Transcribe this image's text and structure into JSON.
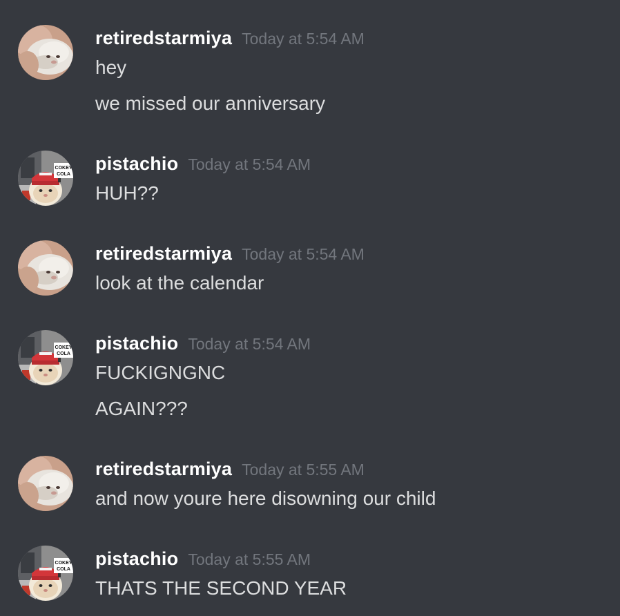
{
  "messages": [
    {
      "username": "retiredstarmiya",
      "timestamp": "Today at 5:54 AM",
      "avatar": "hamster-avatar",
      "lines": [
        "hey",
        "we missed our anniversary"
      ]
    },
    {
      "username": "pistachio",
      "timestamp": "Today at 5:54 AM",
      "avatar": "cat-cap-avatar",
      "lines": [
        "HUH??"
      ]
    },
    {
      "username": "retiredstarmiya",
      "timestamp": "Today at 5:54 AM",
      "avatar": "hamster-avatar",
      "lines": [
        "look at the calendar"
      ]
    },
    {
      "username": "pistachio",
      "timestamp": "Today at 5:54 AM",
      "avatar": "cat-cap-avatar",
      "lines": [
        "FUCKIGNGNC",
        "AGAIN???"
      ]
    },
    {
      "username": "retiredstarmiya",
      "timestamp": "Today at 5:55 AM",
      "avatar": "hamster-avatar",
      "lines": [
        "and now youre here disowning our child"
      ]
    },
    {
      "username": "pistachio",
      "timestamp": "Today at 5:55 AM",
      "avatar": "cat-cap-avatar",
      "lines": [
        "THATS THE SECOND YEAR"
      ]
    }
  ],
  "avatar_sign_text": {
    "line1": "COKEY",
    "line2": "COLA"
  },
  "colors": {
    "background": "#36393f",
    "username": "#ffffff",
    "timestamp": "#72767d",
    "message_text": "#dcddde"
  }
}
